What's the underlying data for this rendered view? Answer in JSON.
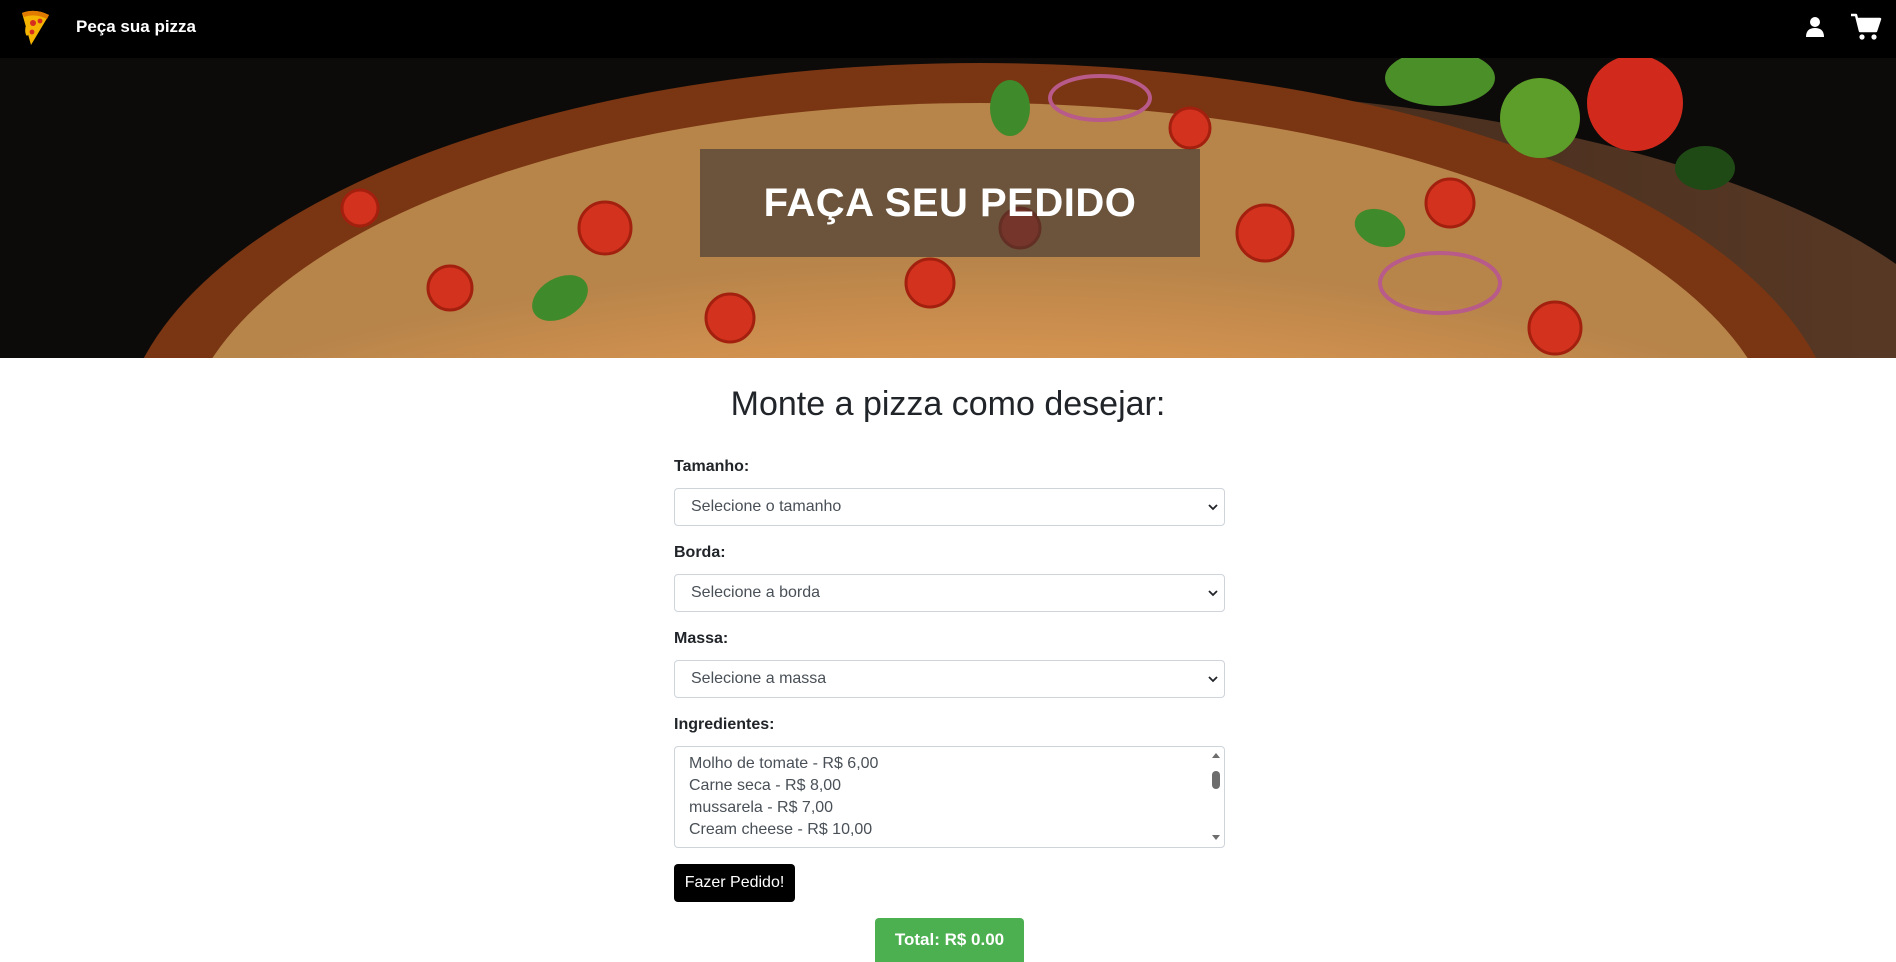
{
  "navbar": {
    "brand_name": "Peça sua pizza"
  },
  "icons": {
    "logo": "pizza-slice-icon",
    "user": "user-icon",
    "cart": "shopping-cart-icon"
  },
  "hero": {
    "title": "FAÇA SEU PEDIDO"
  },
  "form": {
    "title": "Monte a pizza como desejar:",
    "size": {
      "label": "Tamanho:",
      "selected": "Selecione o tamanho"
    },
    "crust": {
      "label": "Borda:",
      "selected": "Selecione a borda"
    },
    "dough": {
      "label": "Massa:",
      "selected": "Selecione a massa"
    },
    "ingredients": {
      "label": "Ingredientes:",
      "options": [
        "Molho de tomate - R$ 6,00",
        "Carne seca - R$ 8,00",
        "mussarela - R$ 7,00",
        "Cream cheese - R$ 10,00"
      ]
    },
    "submit_label": "Fazer Pedido!"
  },
  "total": {
    "label": "Total: R$ 0.00"
  },
  "colors": {
    "navbar_bg": "#000000",
    "total_bg": "#4caf50",
    "button_bg": "#000000"
  }
}
